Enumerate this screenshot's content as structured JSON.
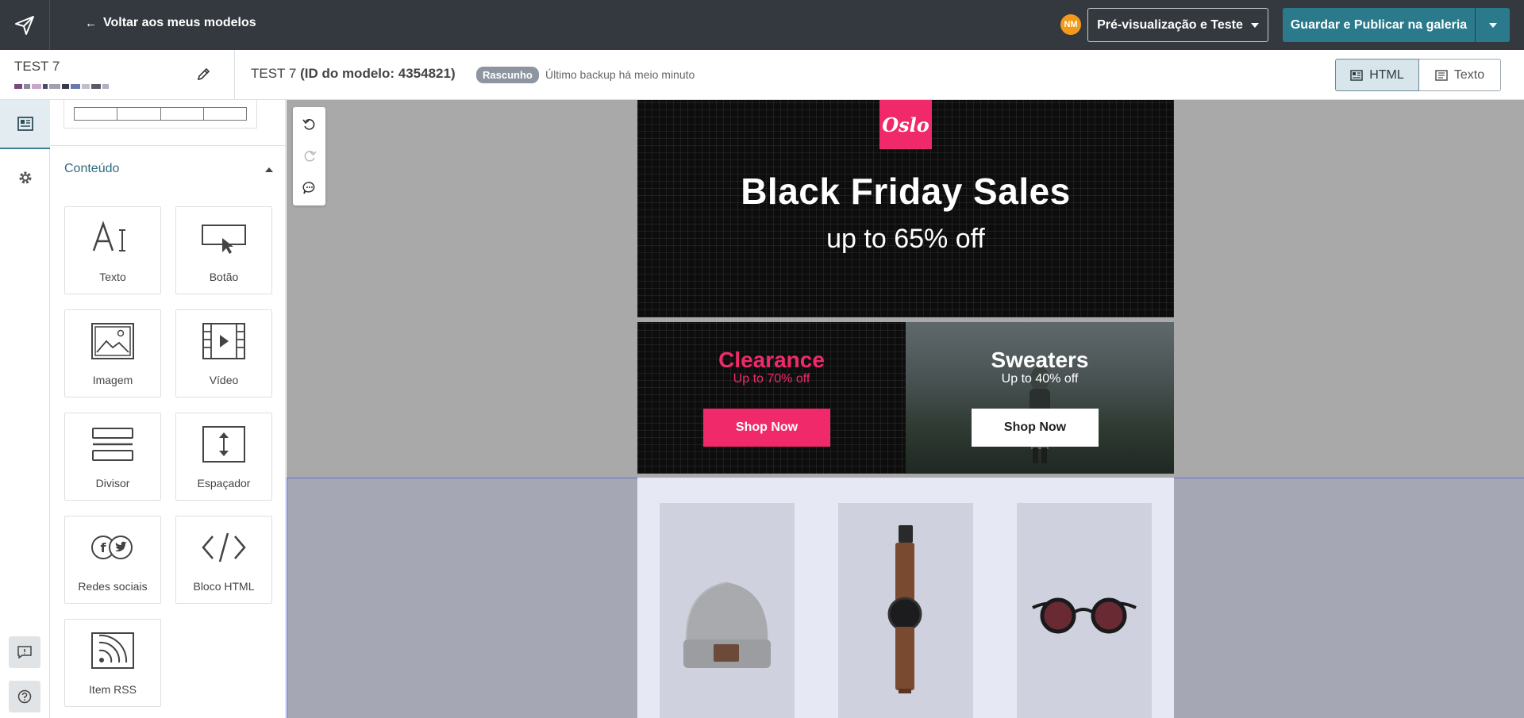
{
  "header": {
    "back_label": "Voltar aos meus modelos",
    "avatar_initials": "NM",
    "preview_label": "Pré-visualização e Teste",
    "publish_label": "Guardar e Publicar na galeria"
  },
  "template": {
    "name": "TEST 7",
    "title_name": "TEST 7",
    "title_id": "(ID do modelo: 4354821)",
    "status_badge": "Rascunho",
    "backup_text": "Último backup há meio minuto"
  },
  "view_toggle": {
    "html_label": "HTML",
    "text_label": "Texto",
    "active": "HTML"
  },
  "panel": {
    "section_title": "Conteúdo",
    "blocks": [
      {
        "label": "Texto",
        "icon": "text-icon"
      },
      {
        "label": "Botão",
        "icon": "button-icon"
      },
      {
        "label": "Imagem",
        "icon": "image-icon"
      },
      {
        "label": "Vídeo",
        "icon": "video-icon"
      },
      {
        "label": "Divisor",
        "icon": "divider-icon"
      },
      {
        "label": "Espaçador",
        "icon": "spacer-icon"
      },
      {
        "label": "Redes sociais",
        "icon": "social-icon"
      },
      {
        "label": "Bloco HTML",
        "icon": "code-icon"
      },
      {
        "label": "Item RSS",
        "icon": "rss-icon"
      }
    ]
  },
  "email": {
    "logo_text": "Oslo",
    "hero_title": "Black Friday Sales",
    "hero_subtitle": "up to 65% off",
    "promo_left": {
      "title": "Clearance",
      "subtitle": "Up to 70% off",
      "button": "Shop Now"
    },
    "promo_right": {
      "title": "Sweaters",
      "subtitle": "Up to 40% off",
      "button": "Shop Now"
    },
    "products": [
      "beanie",
      "watch",
      "sunglasses"
    ]
  },
  "colors": {
    "topbar": "#34393f",
    "accent": "#2a7a8c",
    "brand_pink": "#f02a6a",
    "avatar": "#f39a1c",
    "canvas": "#a9a9a9"
  }
}
